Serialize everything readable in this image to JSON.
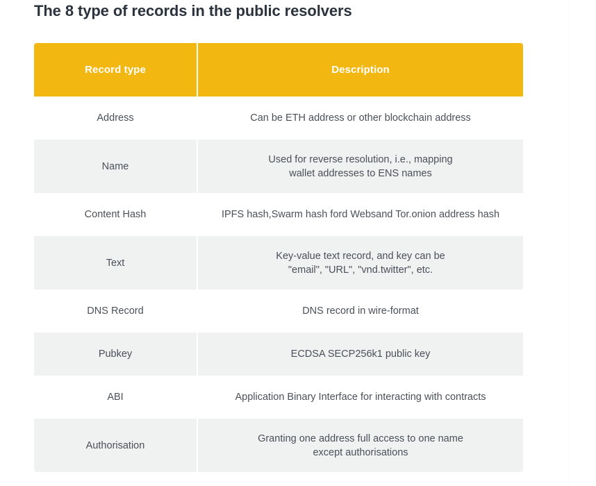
{
  "page": {
    "title": "The 8 type of records in the public resolvers",
    "accent_color": "#f3b711",
    "header_text_color": "#ffffff",
    "body_text_color": "#4a5059",
    "title_color": "#2b333e",
    "stripe_color": "#f0f1f1"
  },
  "table": {
    "columns": [
      {
        "label": "Record type"
      },
      {
        "label": "Description"
      }
    ],
    "rows": [
      {
        "type": "Address",
        "description_lines": [
          "Can be ETH address or other blockchain address"
        ]
      },
      {
        "type": "Name",
        "description_lines": [
          "Used for reverse resolution, i.e., mapping",
          "wallet addresses to ENS names"
        ]
      },
      {
        "type": "Content Hash",
        "description_lines": [
          "IPFS hash,Swarm hash ford Websand Tor.onion address hash"
        ]
      },
      {
        "type": "Text",
        "description_lines": [
          "Key-value text record, and key can be",
          "\"email\", \"URL\", \"vnd.twitter\", etc."
        ]
      },
      {
        "type": "DNS Record",
        "description_lines": [
          "DNS record in wire-format"
        ]
      },
      {
        "type": "Pubkey",
        "description_lines": [
          "ECDSA SECP256k1 public key"
        ]
      },
      {
        "type": "ABI",
        "description_lines": [
          "Application Binary Interface for interacting with contracts"
        ]
      },
      {
        "type": "Authorisation",
        "description_lines": [
          "Granting one address full access to one name",
          "except authorisations"
        ]
      }
    ]
  }
}
